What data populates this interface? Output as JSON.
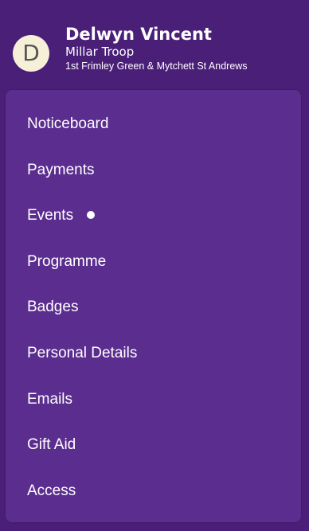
{
  "user": {
    "avatar_initial": "D",
    "name": "Delwyn Vincent",
    "troop": "Millar Troop",
    "group": "1st Frimley Green & Mytchett St Andrews"
  },
  "menu": {
    "items": [
      {
        "label": "Noticeboard"
      },
      {
        "label": "Payments"
      },
      {
        "label": "Events",
        "has_notification_dot": true
      },
      {
        "label": "Programme"
      },
      {
        "label": "Badges"
      },
      {
        "label": "Personal Details"
      },
      {
        "label": "Emails"
      },
      {
        "label": "Gift Aid"
      },
      {
        "label": "Access"
      }
    ]
  },
  "colors": {
    "header_background": "#4a1f78",
    "menu_background": "#5b2d8f",
    "avatar_background": "#f7f0d8",
    "text": "#ffffff"
  }
}
